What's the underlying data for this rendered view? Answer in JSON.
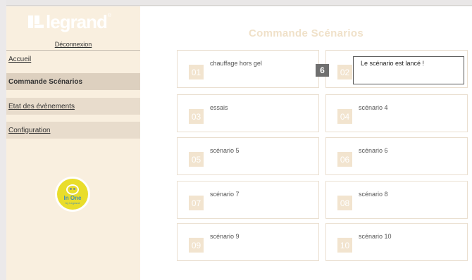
{
  "sidebar": {
    "logo_text": "legrand",
    "logo_mark": "®",
    "logout_label": "Déconnexion",
    "nav": [
      {
        "label": "Accueil"
      },
      {
        "label": "Commande Scénarios"
      },
      {
        "label": "Etat des évènements"
      },
      {
        "label": "Configuration"
      }
    ],
    "badge": {
      "title": "In One",
      "subtitle": "by Legrand"
    }
  },
  "main": {
    "title": "Commande Scénarios",
    "scenarios": [
      {
        "num": "01",
        "label": "chauffage hors gel"
      },
      {
        "num": "02",
        "label": ""
      },
      {
        "num": "03",
        "label": "essais"
      },
      {
        "num": "04",
        "label": "scénario 4"
      },
      {
        "num": "05",
        "label": "scénario 5"
      },
      {
        "num": "06",
        "label": "scénario 6"
      },
      {
        "num": "07",
        "label": "scénario 7"
      },
      {
        "num": "08",
        "label": "scénario 8"
      },
      {
        "num": "09",
        "label": "scénario 9"
      },
      {
        "num": "10",
        "label": "scénario 10"
      }
    ],
    "toast_message": "Le scénario est lancé !",
    "step_number": "6"
  },
  "colors": {
    "sidebar_bg": "#f9efdf",
    "nav_active": "#ddd0bf",
    "tile_number_bg": "#f2e4cf",
    "title_color": "#f0e1c9",
    "step_badge": "#6f6f6f"
  }
}
